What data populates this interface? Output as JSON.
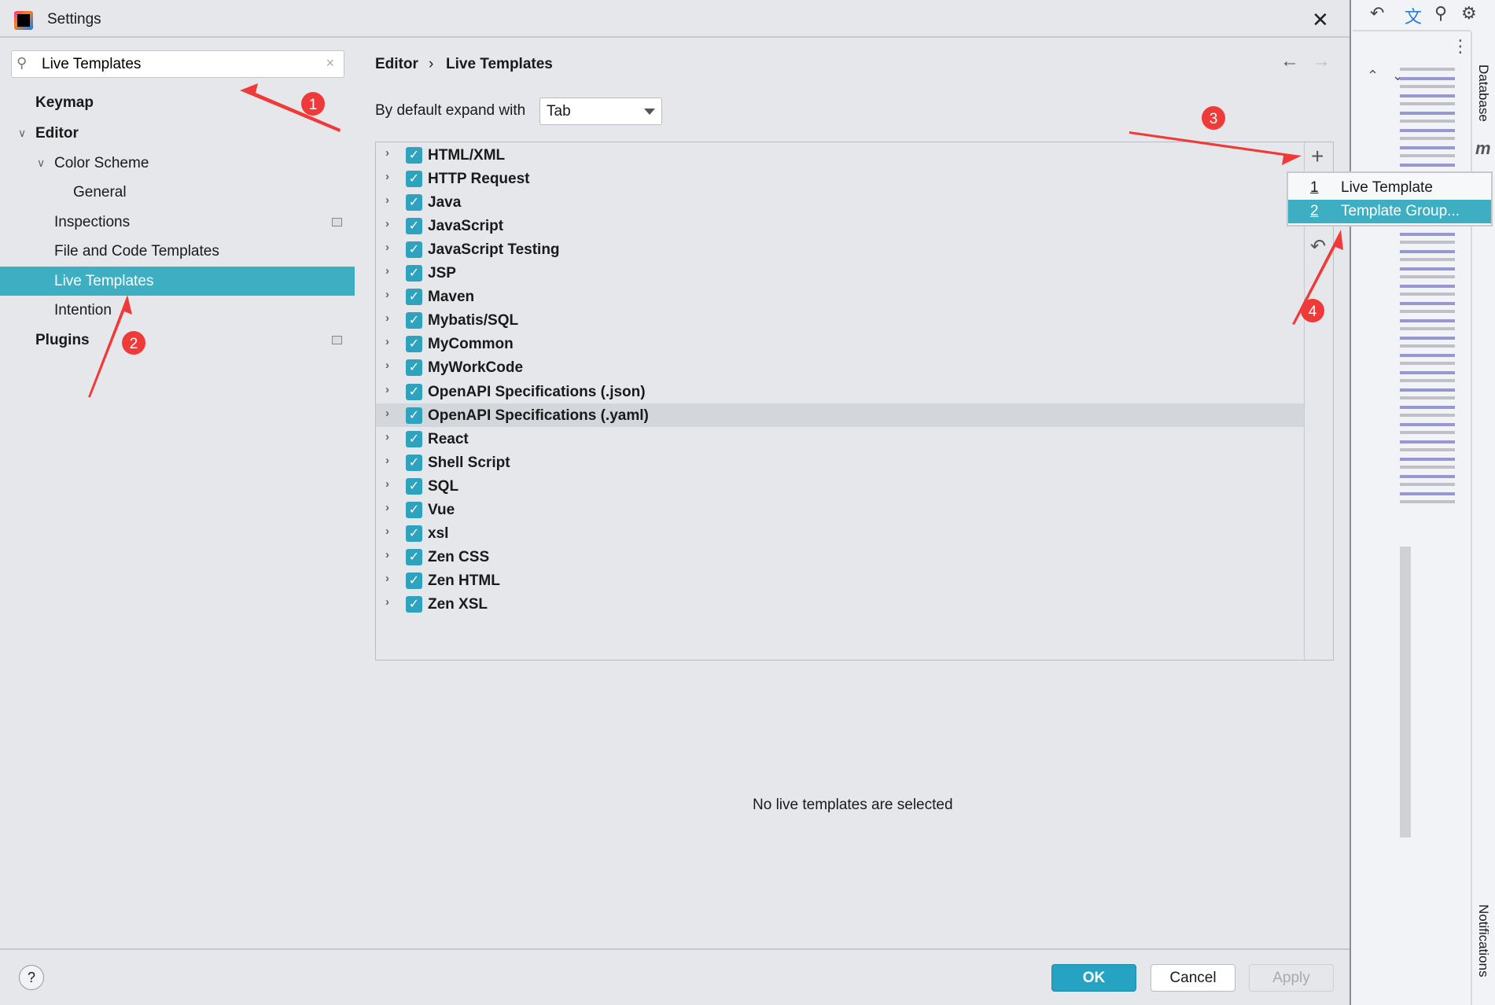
{
  "window": {
    "title": "Settings",
    "close": "✕"
  },
  "search": {
    "value": "Live Templates",
    "icon": "search-icon",
    "clear": "×"
  },
  "sidebar": {
    "items": [
      {
        "label": "Keymap",
        "bold": true,
        "indent": 0
      },
      {
        "label": "Editor",
        "bold": true,
        "indent": 0,
        "expanded": true
      },
      {
        "label": "Color Scheme",
        "indent": 1,
        "expanded": true
      },
      {
        "label": "General",
        "indent": 2
      },
      {
        "label": "Inspections",
        "indent": 1,
        "badge": true
      },
      {
        "label": "File and Code Templates",
        "indent": 1
      },
      {
        "label": "Live Templates",
        "indent": 1,
        "selected": true
      },
      {
        "label": "Intention",
        "indent": 1
      },
      {
        "label": "Plugins",
        "bold": true,
        "indent": 0,
        "badge": true
      }
    ]
  },
  "breadcrumb": {
    "parent": "Editor",
    "sep": "›",
    "current": "Live Templates"
  },
  "expand": {
    "label": "By default expand with",
    "value": "Tab"
  },
  "groups": [
    "HTML/XML",
    "HTTP Request",
    "Java",
    "JavaScript",
    "JavaScript Testing",
    "JSP",
    "Maven",
    "Mybatis/SQL",
    "MyCommon",
    "MyWorkCode",
    "OpenAPI Specifications (.json)",
    "OpenAPI Specifications (.yaml)",
    "React",
    "Shell Script",
    "SQL",
    "Vue",
    "xsl",
    "Zen CSS",
    "Zen HTML",
    "Zen XSL"
  ],
  "highlighted_group": "OpenAPI Specifications (.yaml)",
  "add_menu": [
    {
      "num": "1",
      "label": "Live Template"
    },
    {
      "num": "2",
      "label": "Template Group...",
      "active": true
    }
  ],
  "empty_message": "No live templates are selected",
  "footer": {
    "ok": "OK",
    "cancel": "Cancel",
    "apply": "Apply",
    "help": "?"
  },
  "ide": {
    "database": "Database",
    "notifications": "Notifications",
    "maven": "m"
  },
  "annotations": [
    "1",
    "2",
    "3",
    "4"
  ],
  "colors": {
    "accent": "#3eafc3",
    "ok": "#26a3c2",
    "annotation": "#f03a3a"
  }
}
